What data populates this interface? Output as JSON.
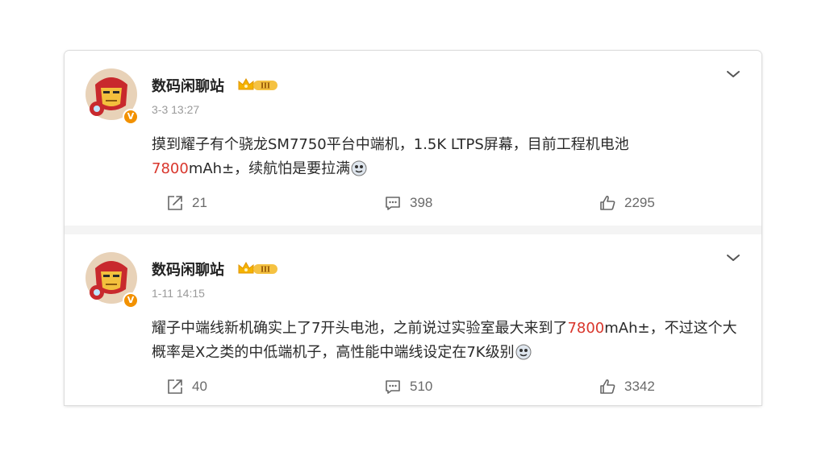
{
  "posts": [
    {
      "username": "数码闲聊站",
      "vip_level": "III",
      "verified_mark": "V",
      "time": "3-3 13:27",
      "content": {
        "part1": "摸到耀子有个骁龙SM7750平台中端机，1.5K LTPS屏幕，目前工程机电池",
        "highlight": "7800",
        "part2": "mAh±，续航怕是要拉满"
      },
      "actions": {
        "share": "21",
        "comment": "398",
        "like": "2295"
      }
    },
    {
      "username": "数码闲聊站",
      "vip_level": "III",
      "verified_mark": "V",
      "time": "1-11 14:15",
      "content": {
        "part1": "耀子中端线新机确实上了7开头电池，之前说过实验室最大来到了",
        "highlight": "7800",
        "part2": "mAh±，不过这个大概率是X之类的中低端机子，高性能中端线设定在7K级别"
      },
      "actions": {
        "share": "40",
        "comment": "510",
        "like": "3342"
      }
    }
  ],
  "colors": {
    "highlight": "#d9362c",
    "verified_badge": "#f29100",
    "vip_badge": "#f5c242"
  },
  "icons": {
    "menu": "chevron-down-icon",
    "share": "share-icon",
    "comment": "comment-icon",
    "like": "thumbs-up-icon",
    "emoji": "emoji-icon"
  }
}
